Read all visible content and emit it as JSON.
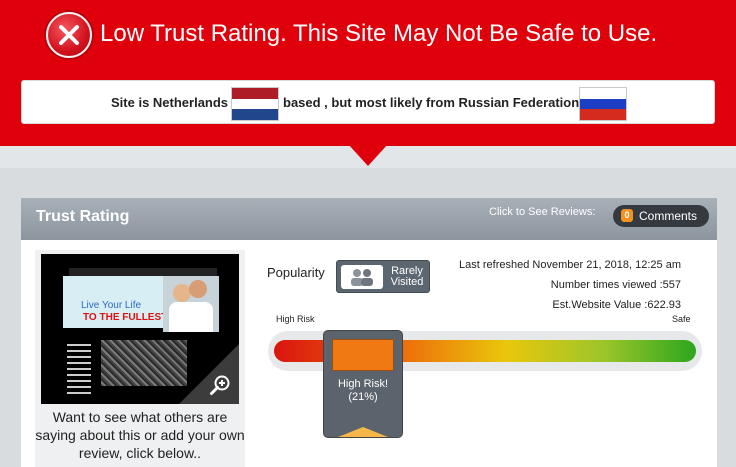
{
  "banner": {
    "title": "Low Trust Rating. This Site May Not Be Safe to Use.",
    "location_prefix": "Site is Netherlands",
    "location_middle": "based , but most likely from Russian Federation",
    "flag_nl": "netherlands-flag-icon",
    "flag_ru": "russian-federation-flag-icon"
  },
  "card": {
    "title": "Trust Rating",
    "click_to_see": "Click to See Reviews:",
    "comments_count": "0",
    "comments_label": "Comments"
  },
  "thumb": {
    "line1": "Live Your Life",
    "line2": "TO THE FULLEST",
    "caption": "Want to see what others are saying about this or add your own review, click below.."
  },
  "popularity": {
    "label": "Popularity",
    "badge": "Rarely Visited"
  },
  "meta": {
    "last_refreshed": "Last refreshed November 21, 2018, 12:25 am",
    "times_viewed": "Number times viewed :557",
    "website_value": "Est.Website Value :622.93"
  },
  "risk": {
    "left_label": "High Risk",
    "right_label": "Safe",
    "marker_title": "High Risk!",
    "marker_percent": "(21%)",
    "score_fraction": 0.21
  },
  "colors": {
    "banner_red": "#e0000b",
    "marker_orange": "#ef7a14"
  }
}
